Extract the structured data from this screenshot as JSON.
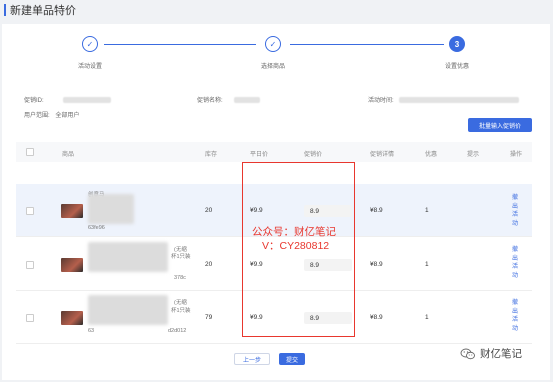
{
  "page": {
    "title": "新建单品特价"
  },
  "steps": [
    {
      "label": "活动设置",
      "state": "done",
      "mark": "✓"
    },
    {
      "label": "选择商品",
      "state": "done",
      "mark": "✓"
    },
    {
      "label": "设置优惠",
      "state": "active",
      "mark": "3"
    }
  ],
  "info": {
    "promo_id_label": "促销ID:",
    "promo_name_label": "促销名称:",
    "activity_time_label": "活动时间:",
    "user_scope_label": "用户范围:",
    "user_scope_value": "全部用户"
  },
  "batch_button": "批量输入促销价",
  "table": {
    "headers": [
      "商品",
      "库存",
      "平日价",
      "促销价",
      "促销详情",
      "优惠",
      "提示",
      "操作"
    ],
    "rows": [
      {
        "product_top": "创意马",
        "product_code": "63fe96",
        "stock": "20",
        "regular_price": "¥9.9",
        "promo_price": "8.9",
        "detail": "¥8.9",
        "discount": "1",
        "action": "撤出活动"
      },
      {
        "product_top": "(无缩",
        "product_mid": "杯1只装",
        "product_code": "378c",
        "stock": "20",
        "regular_price": "¥9.9",
        "promo_price": "8.9",
        "detail": "¥8.9",
        "discount": "1",
        "action": "撤出活动"
      },
      {
        "product_top": "(无缩",
        "product_mid": "杯1只装",
        "product_code_left": "63",
        "product_code": "d2d012",
        "stock": "79",
        "regular_price": "¥9.9",
        "promo_price": "8.9",
        "detail": "¥8.9",
        "discount": "1",
        "action": "撤出活动"
      }
    ]
  },
  "watermark": {
    "line1": "公众号：财亿笔记",
    "line2": "V：CY280812"
  },
  "footer": {
    "prev": "上一步",
    "submit": "提交"
  },
  "brand": {
    "name": "财亿笔记"
  },
  "colors": {
    "primary": "#3a6be0",
    "highlight": "#e8372e"
  }
}
